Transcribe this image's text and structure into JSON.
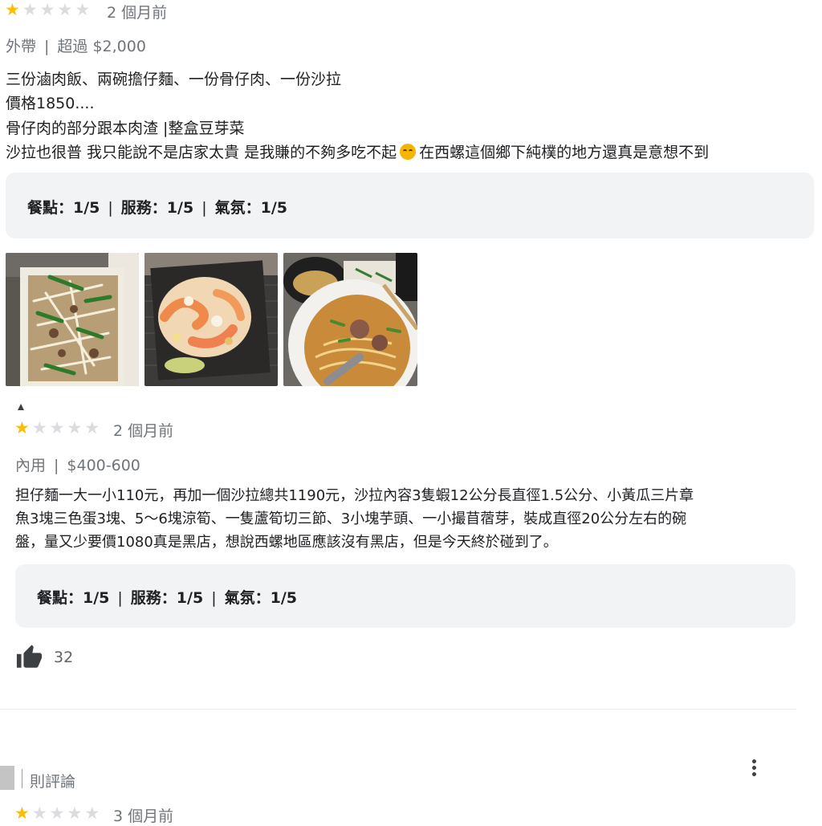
{
  "review1": {
    "stars": 1,
    "stars_total": 5,
    "time": "2 個月前",
    "meta": {
      "type": "外帶",
      "sep": "|",
      "price": "超過 $2,000"
    },
    "lines": [
      "三份滷肉飯、兩碗擔仔麵、一份骨仔肉、一份沙拉",
      "價格1850....",
      "骨仔肉的部分跟本肉渣 |整盒豆芽菜"
    ],
    "line4_a": "沙拉也很普 我只能說不是店家太貴 是我賺的不夠多吃不起",
    "line4_b": "在西螺這個鄉下純樸的地方還真是意想不到",
    "ratings": {
      "food": "餐點：1/5",
      "service": "服務：1/5",
      "atmosphere": "氣氛：1/5",
      "sep": "|"
    },
    "photos": [
      "bean-sprout-pork-box",
      "shrimp-salad-plate",
      "noodle-soup-bowl"
    ]
  },
  "review2": {
    "stars": 1,
    "stars_total": 5,
    "time": "2 個月前",
    "meta": {
      "type": "內用",
      "sep": "|",
      "price": "$400-600"
    },
    "lines": [
      "担仔麵一大一小110元，再加一個沙拉總共1190元，沙拉內容3隻蝦12公分長直徑1.5公分、小黃瓜三片章",
      "魚3塊三色蛋3塊、5～6塊涼筍、一隻蘆筍切三節、3小塊芋頭、一小撮苜蓿芽，裝成直徑20公分左右的碗",
      "盤，量又少要價1080真是黑店，想說西螺地區應該沒有黑店，但是今天終於碰到了。"
    ],
    "ratings": {
      "food": "餐點：1/5",
      "service": "服務：1/5",
      "atmosphere": "氣氛：1/5",
      "sep": "|"
    },
    "likes": "32"
  },
  "review3": {
    "reviewer_count": "則評論",
    "stars": 1,
    "stars_total": 5,
    "time": "3 個月前"
  },
  "icons": {
    "like": "thumb-up-icon",
    "more": "more-vert-icon",
    "star": "star-icon"
  },
  "colors": {
    "star_on": "#fbbc04",
    "star_off": "#dadce0",
    "pill_bg": "#f1f3f4",
    "muted": "#70757a"
  }
}
